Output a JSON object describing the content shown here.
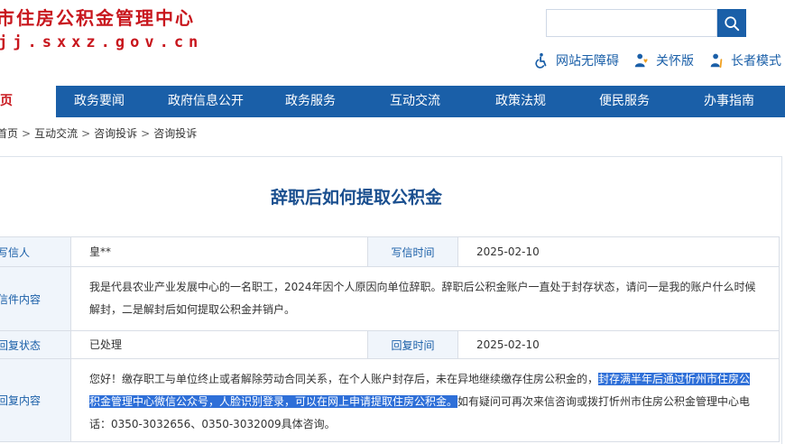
{
  "header": {
    "site_title": "市住房公积金管理中心",
    "site_domain": "jj.sxxz.gov.cn",
    "search": {
      "placeholder": ""
    },
    "tools": [
      {
        "label": "网站无障碍",
        "icon": "accessibility-icon"
      },
      {
        "label": "关怀版",
        "icon": "care-icon"
      },
      {
        "label": "长者模式",
        "icon": "elder-mode-icon"
      }
    ]
  },
  "nav": {
    "items": [
      {
        "label": "页",
        "active": true
      },
      {
        "label": "政务要闻"
      },
      {
        "label": "政府信息公开"
      },
      {
        "label": "政务服务"
      },
      {
        "label": "互动交流"
      },
      {
        "label": "政策法规"
      },
      {
        "label": "便民服务"
      },
      {
        "label": "办事指南"
      }
    ]
  },
  "breadcrumb": [
    "首页",
    "互动交流",
    "咨询投诉",
    "咨询投诉"
  ],
  "letter": {
    "title": "辞职后如何提取公积金",
    "writer_label": "写信人",
    "writer_value": "皇**",
    "write_time_label": "写信时间",
    "write_time_value": "2025-02-10",
    "content_label": "信件内容",
    "content_value": "我是代县农业产业发展中心的一名职工，2024年因个人原因向单位辞职。辞职后公积金账户一直处于封存状态，请问一是我的账户什么时候解封，二是解封后如何提取公积金并销户。",
    "status_label": "回复状态",
    "status_value": "已处理",
    "reply_time_label": "回复时间",
    "reply_time_value": "2025-02-10",
    "reply_label": "回复内容",
    "reply_part1": "您好！缴存职工与单位终止或者解除劳动合同关系，在个人账户封存后，未在异地继续缴存住房公积金的，",
    "reply_highlight": "封存满半年后通过忻州市住房公积金管理中心微信公众号，人脸识别登录，可以在网上申请提取住房公积金。",
    "reply_part2": "如有疑问可再次来信咨询或拨打忻州市住房公积金管理中心电话：0350-3032656、0350-3032009具体咨询。"
  },
  "colors": {
    "brand_red": "#c8161d",
    "nav_blue": "#1a5fa8",
    "label_bg": "#f0f5fb",
    "highlight": "#2e6fd8"
  }
}
